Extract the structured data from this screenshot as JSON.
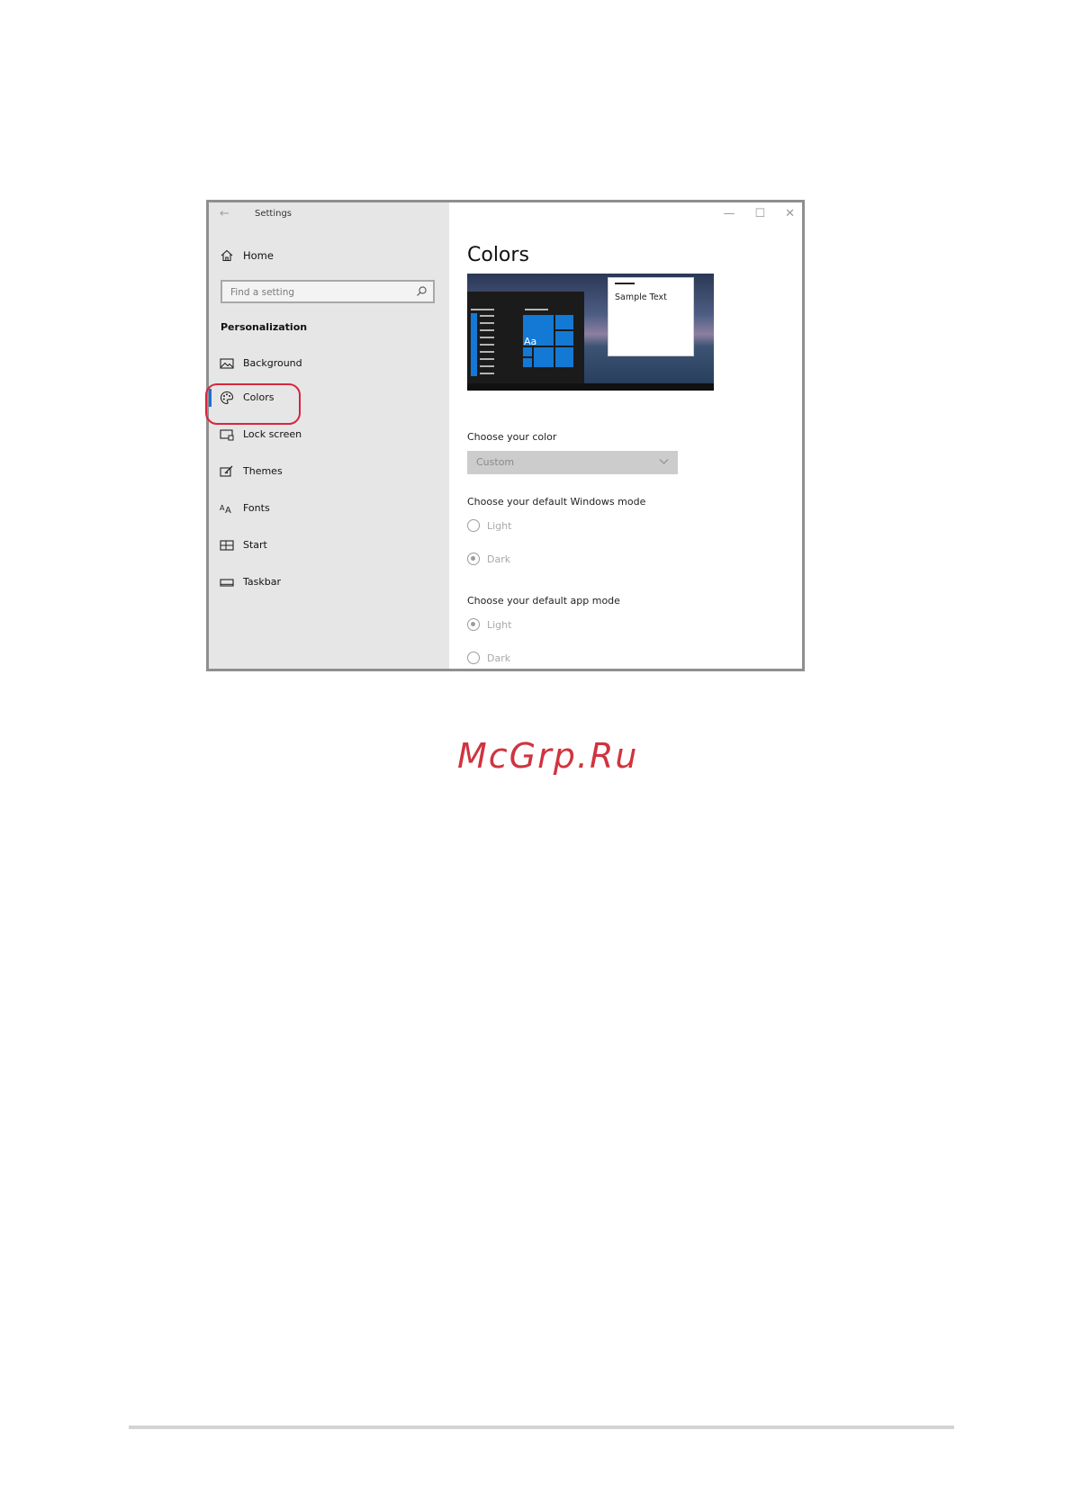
{
  "window": {
    "title": "Settings",
    "back_glyph": "←",
    "controls": {
      "minimize": "—",
      "maximize": "☐",
      "close": "✕"
    }
  },
  "sidebar": {
    "home_label": "Home",
    "search_placeholder": "Find a setting",
    "section_title": "Personalization",
    "items": [
      {
        "label": "Background",
        "icon": "image-icon",
        "active": false
      },
      {
        "label": "Colors",
        "icon": "palette-icon",
        "active": true
      },
      {
        "label": "Lock screen",
        "icon": "lock-screen-icon",
        "active": false
      },
      {
        "label": "Themes",
        "icon": "themes-icon",
        "active": false
      },
      {
        "label": "Fonts",
        "icon": "fonts-icon",
        "active": false
      },
      {
        "label": "Start",
        "icon": "start-icon",
        "active": false
      },
      {
        "label": "Taskbar",
        "icon": "taskbar-icon",
        "active": false
      }
    ]
  },
  "main": {
    "title": "Colors",
    "preview": {
      "sample_text": "Sample Text",
      "tile_text": "Aa"
    },
    "choose_color": {
      "label": "Choose your color",
      "value": "Custom"
    },
    "windows_mode": {
      "label": "Choose your default Windows mode",
      "options": [
        {
          "label": "Light",
          "selected": false
        },
        {
          "label": "Dark",
          "selected": true
        }
      ]
    },
    "app_mode": {
      "label": "Choose your default app mode",
      "options": [
        {
          "label": "Light",
          "selected": true
        },
        {
          "label": "Dark",
          "selected": false
        }
      ]
    }
  },
  "colors": {
    "accent": "#1f6fd1",
    "tile_blue": "#1479d4",
    "highlight_ring": "#d7263d",
    "watermark": "#d0343f"
  },
  "watermark": "McGrp.Ru"
}
